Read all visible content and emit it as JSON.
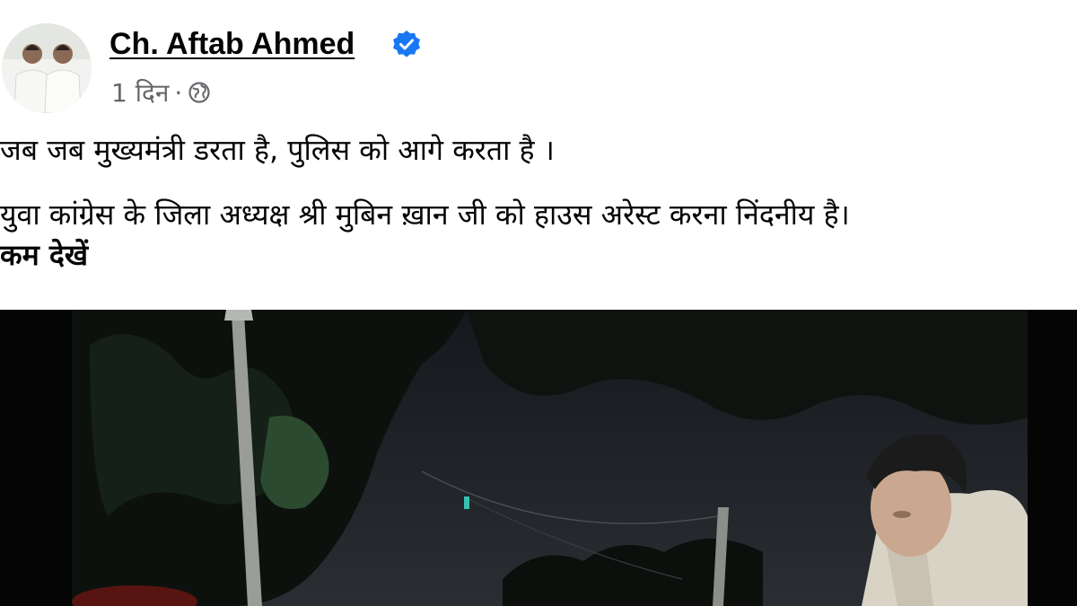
{
  "post": {
    "author_name": "Ch. Aftab Ahmed",
    "timestamp": "1 दिन",
    "separator": "·",
    "privacy_icon": "globe-icon",
    "verified_icon": "verified-badge-icon",
    "text_line_1": "जब जब मुख्यमंत्री डरता है, पुलिस को आगे करता है ।",
    "text_line_2": "युवा कांग्रेस के जिला अध्यक्ष श्री मुबिन ख़ान जी को हाउस अरेस्ट करना निंदनीय है।",
    "see_less": "कम देखें"
  },
  "colors": {
    "verified": "#1877f2",
    "meta_text": "#65676b",
    "body_text": "#050505",
    "media_bg": "#0a0a0a"
  }
}
